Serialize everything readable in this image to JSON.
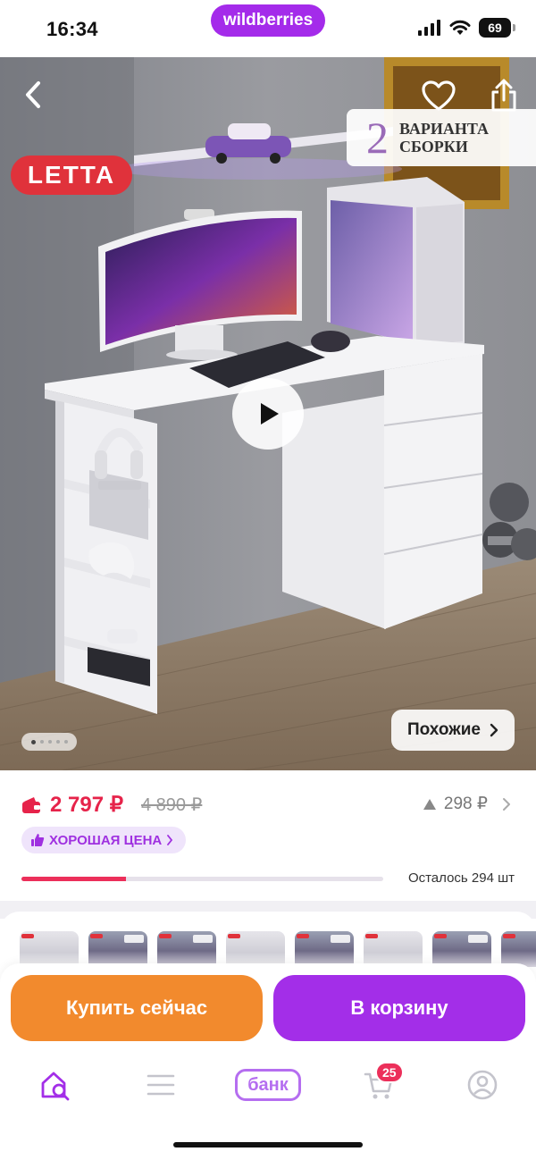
{
  "status_bar": {
    "time": "16:34",
    "battery": "69"
  },
  "top_pill": {
    "label": "wildberries"
  },
  "hero": {
    "variants_number": "2",
    "variants_text": "ВАРИАНТА\nСБОРКИ",
    "brand": "LETTA",
    "similar_label": "Похожие",
    "slides_total": 5,
    "slide_active": 1
  },
  "price": {
    "current": "2 797 ₽",
    "old": "4 890 ₽",
    "trend": "298 ₽",
    "good_price_label": "ХОРОШАЯ ЦЕНА",
    "stock_text": "Осталось 294 шт",
    "stock_fraction": 0.29
  },
  "thumbnails": [
    {
      "tone": "light"
    },
    {
      "tone": "dark"
    },
    {
      "tone": "dark"
    },
    {
      "tone": "light"
    },
    {
      "tone": "dark"
    },
    {
      "tone": "light"
    },
    {
      "tone": "dark"
    },
    {
      "tone": "dark"
    }
  ],
  "actions": {
    "buy_now": "Купить сейчас",
    "add_to_cart": "В корзину"
  },
  "tabbar": {
    "items": [
      {
        "name": "home-search-icon"
      },
      {
        "name": "catalog-icon"
      },
      {
        "name": "bank-tab",
        "label": "банк"
      },
      {
        "name": "cart-icon",
        "badge": "25"
      },
      {
        "name": "profile-icon"
      }
    ]
  },
  "colors": {
    "brand_purple": "#a32ee8",
    "buy_orange": "#f28a2d",
    "price_red": "#e6234a",
    "badge_red": "#e0323b"
  }
}
